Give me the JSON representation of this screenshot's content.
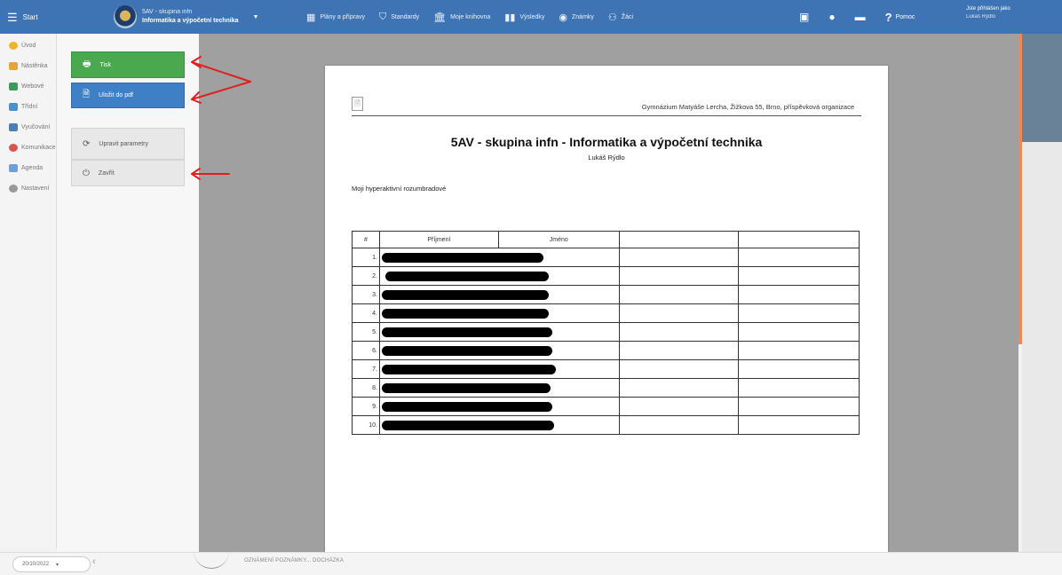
{
  "topbar": {
    "start_label": "Start",
    "course_line1": "5AV - skupina infn",
    "course_line2": "Informatika a výpočetní technika",
    "nav": [
      {
        "label": "Plány a přípravy",
        "icon": "calendar-icon"
      },
      {
        "label": "Standardy",
        "icon": "shield-icon"
      },
      {
        "label": "Moje knihovna",
        "icon": "library-icon"
      },
      {
        "label": "Výsledky",
        "icon": "bar-chart-icon"
      },
      {
        "label": "Známky",
        "icon": "grades-icon"
      },
      {
        "label": "Žáci",
        "icon": "students-icon"
      }
    ],
    "help_label": "Pomoc",
    "user_line1": "Jste přihlášen jako",
    "user_line2": "Lukáš Rýdlo"
  },
  "sidebar": {
    "items": [
      {
        "label": "Úvod",
        "color": "#f0b429"
      },
      {
        "label": "Nástěnka",
        "color": "#e9a23b"
      },
      {
        "label": "Webové",
        "color": "#3d9b5a"
      },
      {
        "label": "Třídní",
        "color": "#4a8fd0"
      },
      {
        "label": "Vyučování",
        "color": "#4a7fb5"
      },
      {
        "label": "Komunikace",
        "color": "#d9534f"
      },
      {
        "label": "Agenda",
        "color": "#6f9fd8"
      },
      {
        "label": "Nastavení",
        "color": "#999999"
      }
    ]
  },
  "print_panel": {
    "print_label": "Tisk",
    "pdf_label": "Uložit do pdf",
    "params_label": "Upravit parametry",
    "close_label": "Zavřít"
  },
  "document": {
    "school": "Gymnázium Matyáše Lercha, Žižkova 55, Brno, příspěvková organizace",
    "title": "5AV - skupina infn - Informatika a výpočetní technika",
    "teacher": "Lukáš Rýdlo",
    "description": "Moji hyperaktivní rozumbradové",
    "columns": [
      "#",
      "Příjmení",
      "Jméno",
      "",
      ""
    ],
    "rows": [
      "1.",
      "2.",
      "3.",
      "4.",
      "5.",
      "6.",
      "7.",
      "8.",
      "9.",
      "10."
    ]
  },
  "bottom": {
    "date": "20/10/2022",
    "tabs": "OZNÁMENÍ  POZNÁMKY...  DOCHÁZKA"
  },
  "colors": {
    "topbar": "#3f74b4",
    "print_button": "#4aa84f",
    "pdf_button": "#3f7fc5",
    "arrow": "#e02020"
  }
}
